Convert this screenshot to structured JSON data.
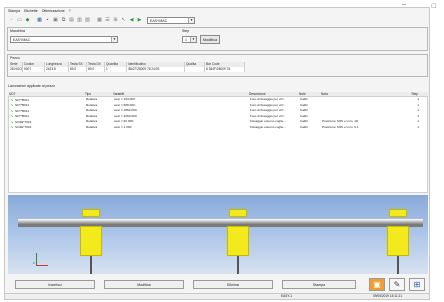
{
  "window": {
    "minimize_glyph": "–",
    "maximize_glyph": "□"
  },
  "menu": [
    "Stampa",
    "Etichette",
    "Ottimizzazione",
    "?"
  ],
  "toolbar": {
    "icons": [
      "new-icon",
      "open-icon",
      "green-tool-icon",
      "grid-icon",
      "pdf-icon",
      "save-icon",
      "copy-icon",
      "paste-icon",
      "print-icon",
      "preview-icon",
      "table-icon",
      "list-icon",
      "measure-icon",
      "cursor-icon",
      "arrow-left-icon",
      "arrow-right-icon"
    ],
    "editor_combo": "EASYMAC"
  },
  "machine": {
    "label_macchina": "Macchina",
    "machine_value": "EASYMAC",
    "label_step": "Step",
    "step_value": "1",
    "modify_button": "Modifica"
  },
  "pezzo": {
    "group_label": "Pezzo",
    "headers": [
      "Serie",
      "Codice",
      "Lunghezza",
      "Testa SX",
      "Testa DX",
      "Quantita",
      "Identificativo",
      "Qualita",
      "Bar Code"
    ],
    "row": [
      "28 NOCH",
      "9007",
      "2423.8",
      "89.0",
      "89.0",
      "1",
      "\\Bb27\\28009 78 24\\03",
      "",
      "8 384F\\28009 78"
    ]
  },
  "lavorazioni": {
    "group_label": "Lavorazioni applicate al pezzo",
    "headers": [
      "UDT",
      "Tipo",
      "Variabili",
      "Descrizione",
      "Note",
      "Nota",
      "Step"
    ],
    "rows": [
      [
        "SFT*B011",
        "Relativa",
        "xear = 184,000;",
        "Foro di fissaggio per vrrf...",
        "Calibi",
        "",
        "1"
      ],
      [
        "SFT*B011",
        "Relativa",
        "xear = 688,000;",
        "Foro di fissaggio per vrrf...",
        "Calibi",
        "",
        "1"
      ],
      [
        "SFT*B011",
        "Relativa",
        "xear = 1862,000;",
        "Foro di fissaggio per vrrf...",
        "Calibi",
        "",
        "1"
      ],
      [
        "SFT*B011",
        "Relativa",
        "xear = 2260,000;",
        "Foro di fissaggio per vrrf...",
        "Calibi",
        "",
        "1"
      ],
      [
        "SO4E*7001",
        "Relativa",
        "xear = 60,000;",
        "Fissaggio esterno coglie...",
        "Calibi",
        "Posizione: MIN +/-mm. 18",
        "1"
      ],
      [
        "SO4E*7001",
        "Relativa",
        "xear = 1,000;",
        "Fissaggio esterno coglie...",
        "Calibi",
        "Posizione: MIN +/-mm. 6.1",
        "1"
      ]
    ]
  },
  "view3d": {
    "axis_label": "Z"
  },
  "bottom_buttons": [
    "Inserisci",
    "Modifica",
    "Elimina",
    "Stampa"
  ],
  "status": {
    "center": "EASY-1",
    "right": "09/05/2019 15:11:21"
  }
}
